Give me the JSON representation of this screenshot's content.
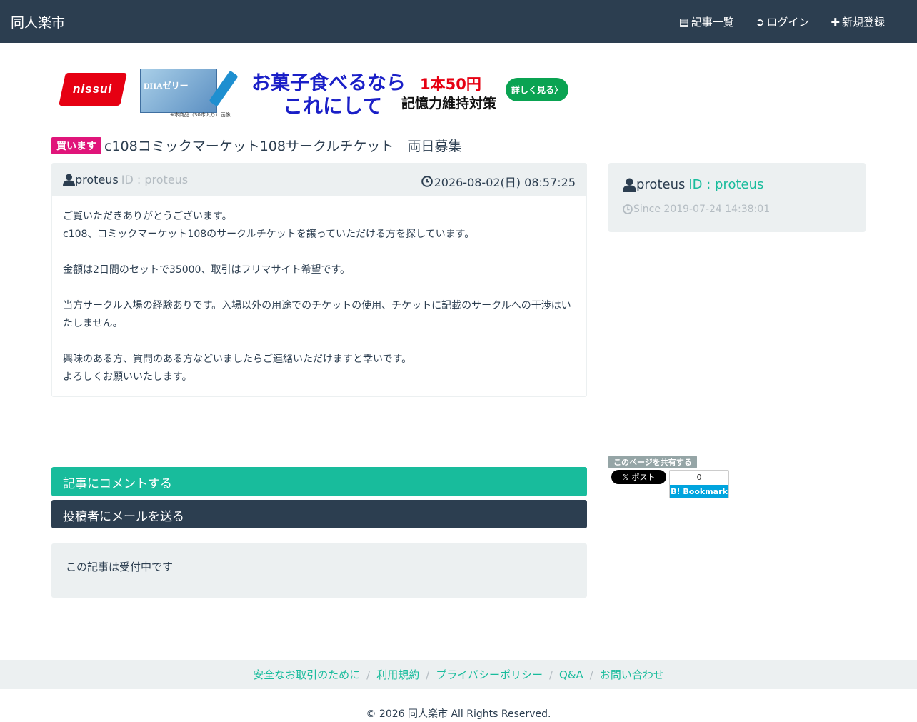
{
  "navbar": {
    "brand": "同人楽市",
    "links": [
      {
        "icon": "list-icon",
        "glyph": "▤",
        "label": "記事一覧"
      },
      {
        "icon": "login-icon",
        "glyph": "➲",
        "label": "ログイン"
      },
      {
        "icon": "plus-icon",
        "glyph": "✚",
        "label": "新規登録"
      }
    ]
  },
  "banner": {
    "brand": "nissui",
    "product_name": "DHAゼリー",
    "product_note": "※本商品（30本入り）画像",
    "headline_1": "お菓子食べるなら",
    "headline_2": "これにして",
    "price": "1本50円",
    "subline": "記憶力維持対策",
    "cta": "詳しく見る〉"
  },
  "post": {
    "badge": "買います",
    "title": "c108コミックマーケット108サークルチケット　両日募集",
    "author": "proteus",
    "id_label": "ID : proteus",
    "date": "2026-08-02(日) 08:57:25",
    "body": [
      "ご覧いただきありがとうございます。",
      "c108、コミックマーケット108のサークルチケットを譲っていただける方を探しています。",
      "",
      "金額は2日間のセットで35000、取引はフリマサイト希望です。",
      "",
      "当方サークル入場の経験ありです。入場以外の用途でのチケットの使用、チケットに記載のサークルへの干渉はいたしません。",
      "",
      "興味のある方、質問のある方などいましたらご連絡いただけますと幸いです。",
      "よろしくお願いいたします。"
    ]
  },
  "profile": {
    "name": "proteus",
    "id_label": "ID : proteus",
    "since": "Since 2019-07-24 14:38:01"
  },
  "share": {
    "label": "このページを共有する",
    "x_post": "ポスト",
    "hatena_count": "0",
    "hatena_label": "B! Bookmark"
  },
  "actions": {
    "comment": "記事にコメントする",
    "mail": "投稿者にメールを送る",
    "status": "この記事は受付中です"
  },
  "footer": {
    "links": [
      "安全なお取引のために",
      "利用規約",
      "プライバシーポリシー",
      "Q&A",
      "お問い合わせ"
    ],
    "copyright": "© 2026 同人楽市 All Rights Reserved."
  },
  "colors": {
    "navbar": "#2c3e50",
    "accent": "#18bc9c",
    "badge": "#e0157a",
    "well": "#ecf0f1"
  }
}
